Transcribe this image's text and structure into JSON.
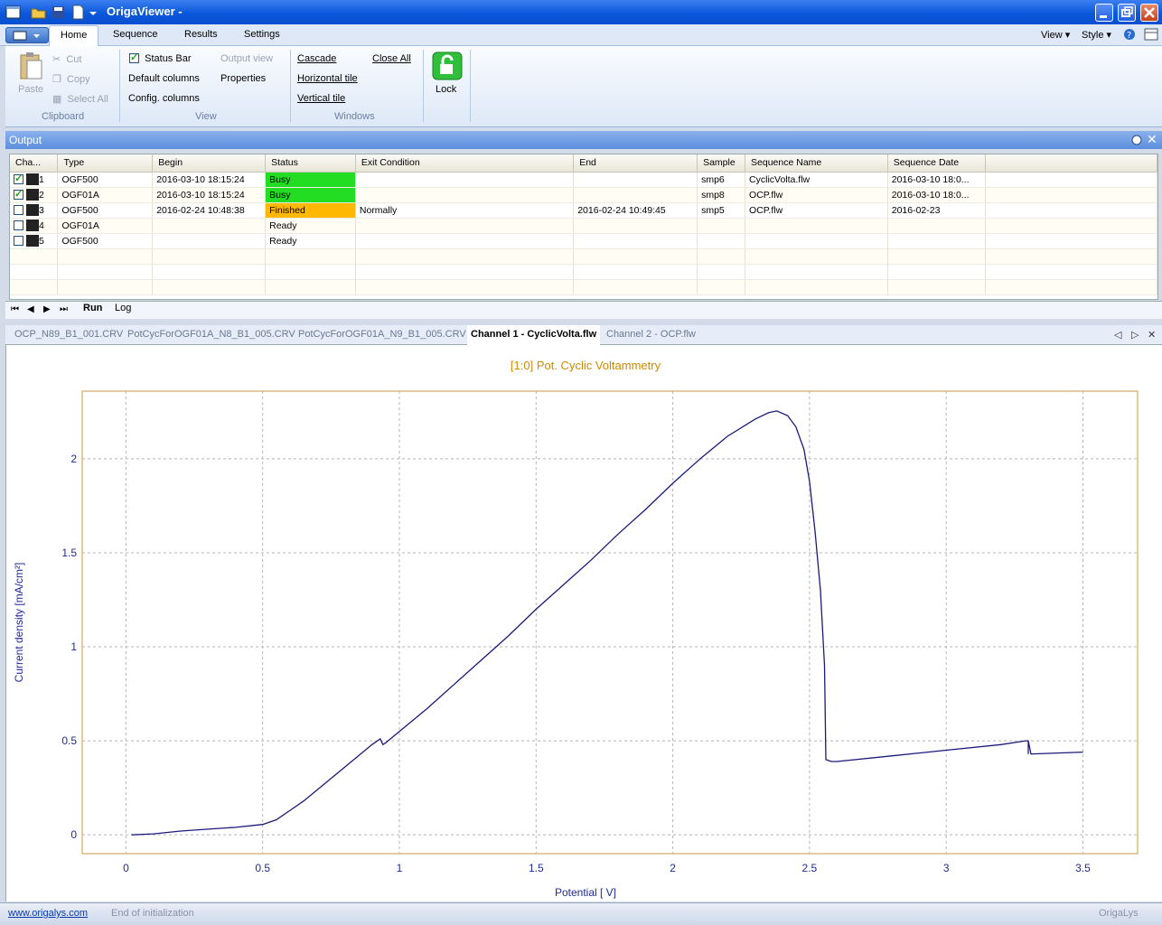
{
  "window": {
    "title": "OrigaViewer -"
  },
  "ribbon_tabs": [
    "Home",
    "Sequence",
    "Results",
    "Settings"
  ],
  "ribbon_right": {
    "view": "View",
    "style": "Style"
  },
  "clipboard": {
    "paste": "Paste",
    "cut": "Cut",
    "copy": "Copy",
    "select_all": "Select All",
    "group": "Clipboard"
  },
  "view_group": {
    "status_bar": "Status Bar",
    "output_view": "Output view",
    "default_columns": "Default columns",
    "properties": "Properties",
    "config_columns": "Config. columns",
    "group": "View"
  },
  "windows_group": {
    "cascade": "Cascade",
    "close_all": "Close All",
    "horizontal_tile": "Horizontal tile",
    "vertical_tile": "Vertical tile",
    "group": "Windows"
  },
  "lock": {
    "label": "Lock"
  },
  "output": {
    "title": "Output"
  },
  "grid": {
    "columns": [
      "Cha...",
      "Type",
      "Begin",
      "Status",
      "Exit Condition",
      "End",
      "Sample",
      "Sequence Name",
      "Sequence Date"
    ],
    "rows": [
      {
        "checked": true,
        "ch": "1",
        "type": "OGF500",
        "begin": "2016-03-10 18:15:24",
        "status": "Busy",
        "status_kind": "busy",
        "exit": "",
        "end": "",
        "sample": "smp6",
        "seq": "CyclicVolta.flw",
        "date": "2016-03-10 18:0..."
      },
      {
        "checked": true,
        "ch": "2",
        "type": "OGF01A",
        "begin": "2016-03-10 18:15:24",
        "status": "Busy",
        "status_kind": "busy",
        "exit": "",
        "end": "",
        "sample": "smp8",
        "seq": "OCP.flw",
        "date": "2016-03-10 18:0..."
      },
      {
        "checked": false,
        "ch": "3",
        "type": "OGF500",
        "begin": "2016-02-24 10:48:38",
        "status": "Finished",
        "status_kind": "finished",
        "exit": "Normally",
        "end": "2016-02-24 10:49:45",
        "sample": "smp5",
        "seq": "OCP.flw",
        "date": "2016-02-23"
      },
      {
        "checked": false,
        "ch": "4",
        "type": "OGF01A",
        "begin": "",
        "status": "Ready",
        "status_kind": "ready",
        "exit": "",
        "end": "",
        "sample": "",
        "seq": "",
        "date": ""
      },
      {
        "checked": false,
        "ch": "5",
        "type": "OGF500",
        "begin": "",
        "status": "Ready",
        "status_kind": "ready",
        "exit": "",
        "end": "",
        "sample": "",
        "seq": "",
        "date": ""
      }
    ]
  },
  "sheet_tabs": [
    "Run",
    "Log"
  ],
  "doc_tabs": [
    "OCP_N89_B1_001.CRV",
    "PotCycForOGF01A_N8_B1_005.CRV",
    "PotCycForOGF01A_N9_B1_005.CRV",
    "Channel 1 - CyclicVolta.flw",
    "Channel 2 - OCP.flw"
  ],
  "active_doc_tab": 3,
  "colors": {
    "curve": "#1a1a7a",
    "title": "#d08a00",
    "axis_text": "#1f2a9a",
    "frame": "#c89a40"
  },
  "chart_data": {
    "type": "line",
    "title": "[1:0] Pot. Cyclic Voltammetry",
    "xlabel": "Potential [ V]",
    "ylabel": "Current density [mA/cm²]",
    "xlim": [
      -0.16,
      3.7
    ],
    "ylim": [
      -0.1,
      2.36
    ],
    "xticks": [
      0,
      0.5,
      1,
      1.5,
      2,
      2.5,
      3,
      3.5
    ],
    "xtick_labels": [
      "0",
      "0.5",
      "1",
      "1.5",
      "2",
      "2.5",
      "3",
      "3.5"
    ],
    "yticks": [
      0,
      0.5,
      1,
      1.5,
      2
    ],
    "ytick_labels": [
      "0",
      "0.5",
      "1",
      "1.5",
      "2"
    ],
    "grid": true,
    "series": [
      {
        "x": [
          0.02,
          0.1,
          0.2,
          0.3,
          0.4,
          0.5,
          0.55,
          0.6,
          0.65,
          0.7,
          0.75,
          0.8,
          0.85,
          0.9,
          0.93,
          0.94,
          0.95,
          1.0,
          1.1,
          1.2,
          1.3,
          1.4,
          1.5,
          1.6,
          1.7,
          1.8,
          1.9,
          2.0,
          2.1,
          2.2,
          2.3,
          2.35,
          2.38,
          2.42,
          2.45,
          2.48,
          2.5,
          2.52,
          2.54,
          2.555,
          2.56,
          2.58,
          2.6,
          2.8,
          3.0,
          3.2,
          3.29,
          3.3,
          3.3,
          3.3,
          3.31,
          3.5
        ],
        "y": [
          0.0,
          0.005,
          0.02,
          0.03,
          0.04,
          0.055,
          0.08,
          0.13,
          0.18,
          0.24,
          0.3,
          0.36,
          0.42,
          0.48,
          0.51,
          0.48,
          0.49,
          0.55,
          0.67,
          0.8,
          0.93,
          1.06,
          1.2,
          1.33,
          1.46,
          1.6,
          1.73,
          1.87,
          2.0,
          2.12,
          2.21,
          2.245,
          2.255,
          2.23,
          2.17,
          2.05,
          1.88,
          1.62,
          1.3,
          0.9,
          0.4,
          0.39,
          0.39,
          0.42,
          0.45,
          0.48,
          0.5,
          0.5,
          0.43,
          0.5,
          0.43,
          0.44
        ]
      }
    ]
  },
  "status": {
    "link": "www.origalys.com",
    "message": "End of initialization",
    "brand": "OrigaLys"
  }
}
